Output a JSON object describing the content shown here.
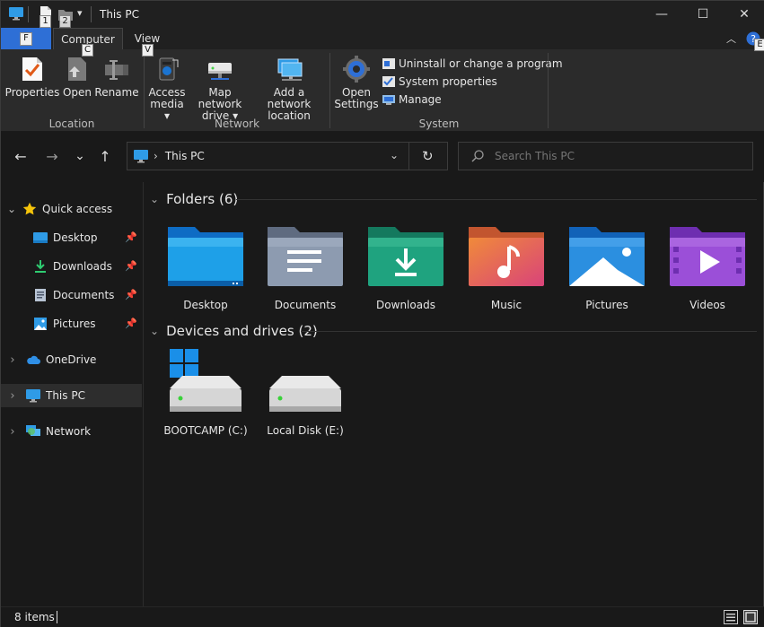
{
  "window": {
    "title": "This PC",
    "controls": {
      "minimize": "—",
      "maximize": "☐",
      "close": "✕"
    }
  },
  "quick_access": {
    "keytips": [
      "1",
      "2"
    ],
    "dropdown": "▾"
  },
  "tabs": [
    {
      "label": "F",
      "keytip": ""
    },
    {
      "label": "Computer",
      "keytip": "C"
    },
    {
      "label": "View",
      "keytip": "V"
    }
  ],
  "ribbon_help_keytip": "E",
  "ribbon": {
    "location": {
      "label": "Location",
      "buttons": [
        {
          "label": "Properties",
          "icon": "properties-icon"
        },
        {
          "label": "Open",
          "icon": "open-icon"
        },
        {
          "label": "Rename",
          "icon": "rename-icon"
        }
      ]
    },
    "network": {
      "label": "Network",
      "buttons": [
        {
          "line1": "Access",
          "line2": "media ▾",
          "icon": "access-media-icon"
        },
        {
          "line1": "Map network",
          "line2": "drive ▾",
          "icon": "map-drive-icon"
        },
        {
          "line1": "Add a network",
          "line2": "location",
          "icon": "network-location-icon"
        }
      ]
    },
    "system": {
      "label": "System",
      "open_settings": {
        "line1": "Open",
        "line2": "Settings",
        "icon": "settings-gear-icon"
      },
      "items": [
        {
          "label": "Uninstall or change a program",
          "icon": "uninstall-icon"
        },
        {
          "label": "System properties",
          "icon": "system-properties-icon"
        },
        {
          "label": "Manage",
          "icon": "manage-icon"
        }
      ]
    }
  },
  "navbar": {
    "back": "←",
    "forward": "→",
    "recent": "⌄",
    "up": "↑",
    "address": {
      "separator": "›",
      "location": "This PC",
      "dropdown": "⌄",
      "refresh": "↻"
    },
    "search": {
      "placeholder": "Search This PC"
    }
  },
  "sidebar": {
    "items": [
      {
        "label": "Quick access",
        "expander": "⌄",
        "pinned": false
      },
      {
        "label": "Desktop",
        "expander": "",
        "pinned": true
      },
      {
        "label": "Downloads",
        "expander": "",
        "pinned": true
      },
      {
        "label": "Documents",
        "expander": "",
        "pinned": true
      },
      {
        "label": "Pictures",
        "expander": "",
        "pinned": true
      },
      {
        "label": "OneDrive",
        "expander": "›",
        "pinned": false
      },
      {
        "label": "This PC",
        "expander": "›",
        "pinned": false,
        "selected": true
      },
      {
        "label": "Network",
        "expander": "›",
        "pinned": false
      }
    ]
  },
  "main": {
    "folders_section": {
      "title": "Folders (6)",
      "chevron": "⌄"
    },
    "folders": [
      {
        "label": "Desktop",
        "icon": "desktop-folder-icon",
        "color": "#1e9be0"
      },
      {
        "label": "Documents",
        "icon": "documents-folder-icon",
        "color": "#8d9bb0"
      },
      {
        "label": "Downloads",
        "icon": "downloads-folder-icon",
        "color": "#1fa37f"
      },
      {
        "label": "Music",
        "icon": "music-folder-icon",
        "color": "#e8664a"
      },
      {
        "label": "Pictures",
        "icon": "pictures-folder-icon",
        "color": "#2b8fe0"
      },
      {
        "label": "Videos",
        "icon": "videos-folder-icon",
        "color": "#9b4fd8"
      }
    ],
    "drives_section": {
      "title": "Devices and drives (2)",
      "chevron": "⌄"
    },
    "drives": [
      {
        "label": "BOOTCAMP (C:)",
        "icon": "windows-drive-icon"
      },
      {
        "label": "Local Disk (E:)",
        "icon": "drive-icon"
      }
    ]
  },
  "status": {
    "item_count": "8 items"
  },
  "colors": {
    "accent": "#2e6fd6",
    "background": "#191919",
    "ribbon": "#2b2b2b"
  }
}
